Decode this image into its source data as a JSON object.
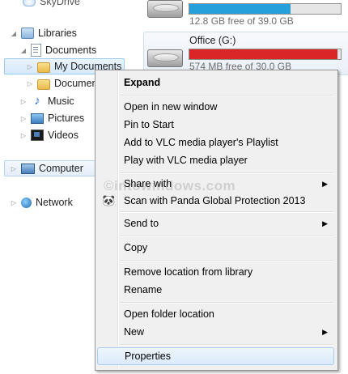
{
  "nav": {
    "skydrive": "SkyDrive",
    "libraries": "Libraries",
    "documents": "Documents",
    "my_documents": "My Documents",
    "documents_sub": "Documents",
    "music": "Music",
    "pictures": "Pictures",
    "videos": "Videos",
    "computer": "Computer",
    "network": "Network"
  },
  "drives": {
    "first": {
      "free_text": "12.8 GB free of 39.0 GB",
      "used_fraction": 0.67,
      "bar_color": "#26a0da"
    },
    "office": {
      "name": "Office (G:)",
      "free_text": "574 MB free of 30.0 GB",
      "used_fraction": 0.98,
      "bar_color": "#da2626"
    }
  },
  "watermark": "©intowindows.com",
  "menu": {
    "expand": "Expand",
    "open_new_window": "Open in new window",
    "pin_to_start": "Pin to Start",
    "add_vlc_playlist": "Add to VLC media player's Playlist",
    "play_vlc": "Play with VLC media player",
    "share_with": "Share with",
    "scan_panda": "Scan with Panda Global Protection 2013",
    "send_to": "Send to",
    "copy": "Copy",
    "remove_location": "Remove location from library",
    "rename": "Rename",
    "open_folder_location": "Open folder location",
    "new": "New",
    "properties": "Properties"
  }
}
